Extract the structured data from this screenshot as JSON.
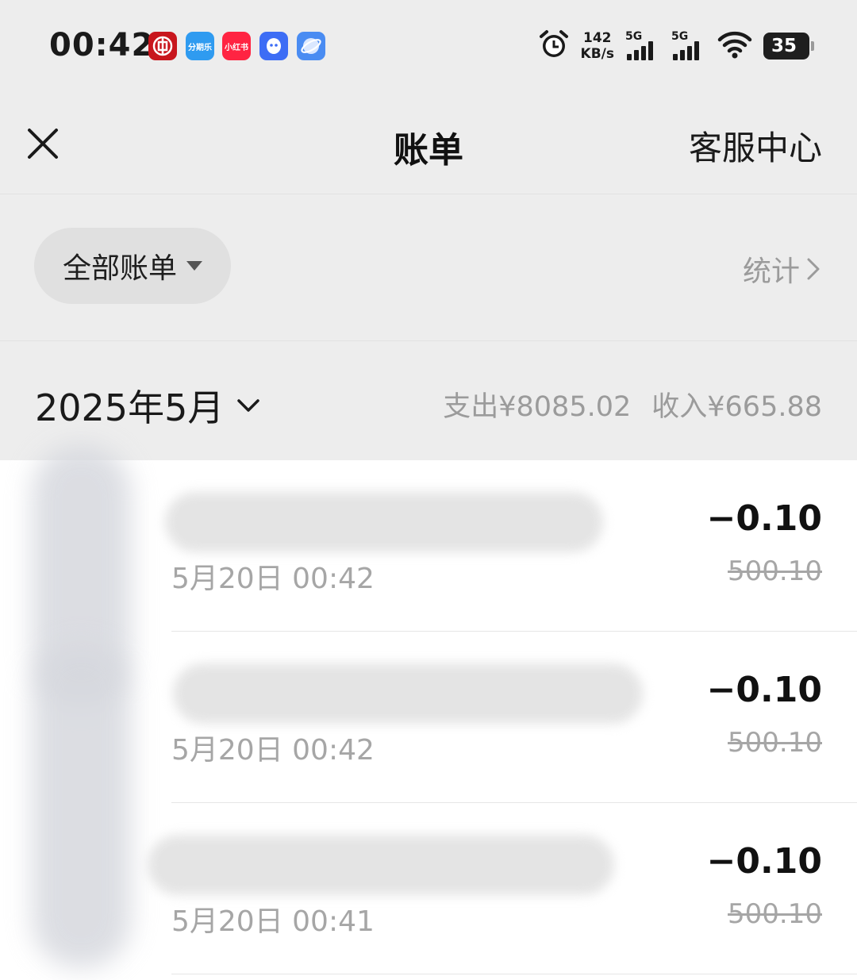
{
  "status_bar": {
    "time": "00:42",
    "apps": [
      {
        "icon": "icbc-app-icon",
        "label": "",
        "color": "#c8161d"
      },
      {
        "icon": "fenqile-app-icon",
        "label": "分期乐",
        "color": "#2f9bf0"
      },
      {
        "icon": "xiaohongshu-app-icon",
        "label": "小红书",
        "color": "#ff2442"
      },
      {
        "icon": "qq-app-icon",
        "label": "",
        "color": "#3d6df5"
      },
      {
        "icon": "browser-app-icon",
        "label": "",
        "color": "#4a8cf2"
      }
    ],
    "net_speed_value": "142",
    "net_speed_unit": "KB/s",
    "signal1_label": "5G",
    "signal2_label": "5G",
    "battery": "35"
  },
  "nav": {
    "title": "账单",
    "service": "客服中心"
  },
  "filter": {
    "label": "全部账单",
    "stats": "统计"
  },
  "month_header": {
    "month": "2025年5月",
    "expense": "支出¥8085.02",
    "income": "收入¥665.88"
  },
  "transactions": [
    {
      "time": "5月20日 00:42",
      "amount": "−0.10",
      "original": "500.10"
    },
    {
      "time": "5月20日 00:42",
      "amount": "−0.10",
      "original": "500.10"
    },
    {
      "time": "5月20日 00:41",
      "amount": "−0.10",
      "original": "500.10"
    }
  ],
  "colors": {
    "header_bg": "#ededed",
    "list_bg": "#ffffff",
    "secondary_text": "#a6a6a6"
  }
}
